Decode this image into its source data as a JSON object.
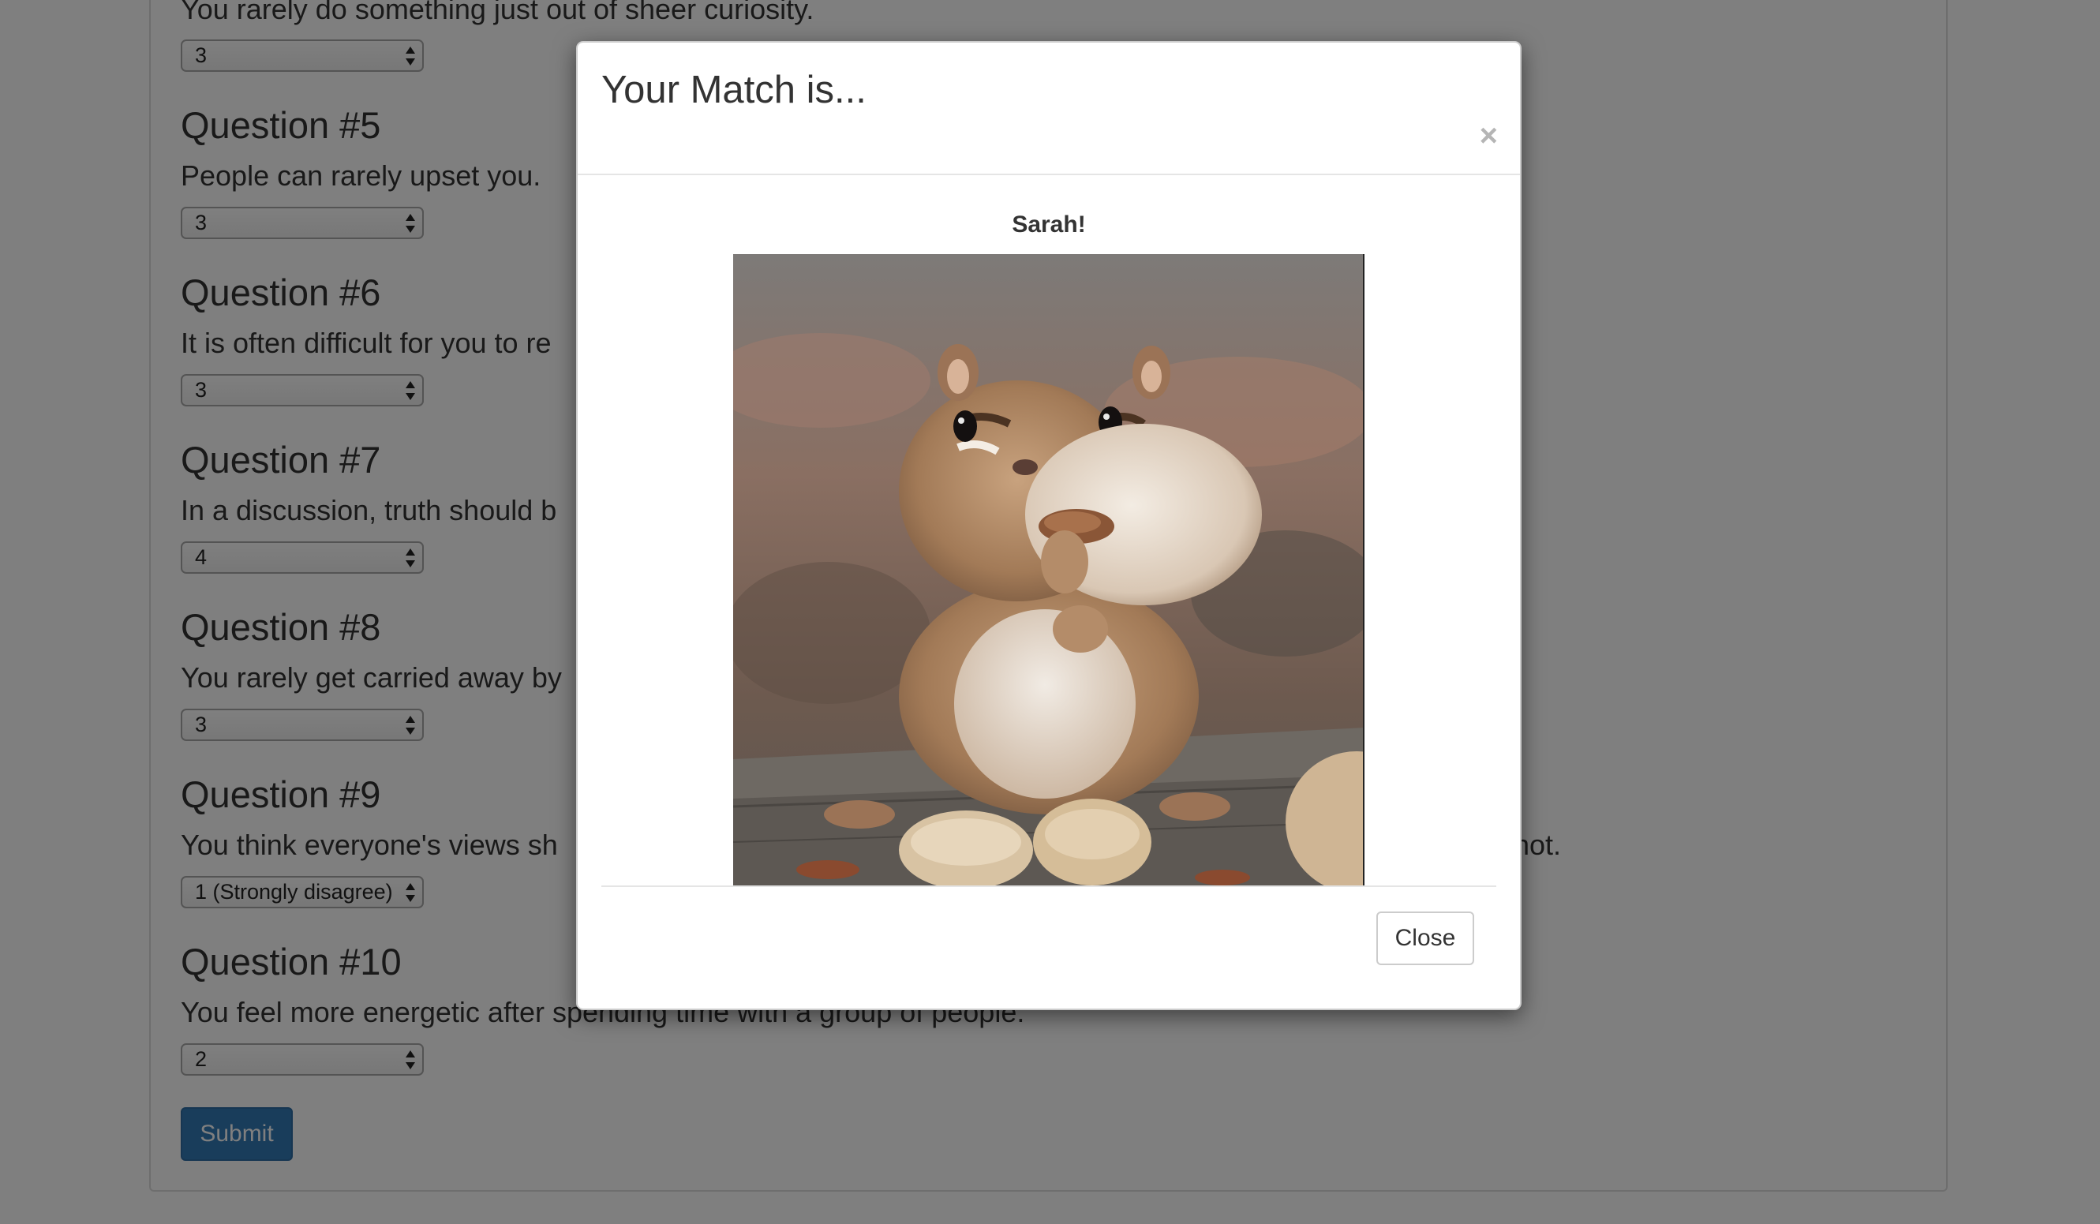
{
  "page": {
    "partial_question_text": "You rarely do something just out of sheer curiosity.",
    "partial_question_value": "3",
    "questions": [
      {
        "heading": "Question #5",
        "text": "People can rarely upset you.",
        "value": "3"
      },
      {
        "heading": "Question #6",
        "text": "It is often difficult for you to re",
        "value": "3"
      },
      {
        "heading": "Question #7",
        "text": "In a discussion, truth should b",
        "value": "4"
      },
      {
        "heading": "Question #8",
        "text": "You rarely get carried away by",
        "value": "3"
      },
      {
        "heading": "Question #9",
        "text": "You think everyone's views sh",
        "text_tail": "not.",
        "value": "1 (Strongly disagree)"
      },
      {
        "heading": "Question #10",
        "text": "You feel more energetic after spending time with a group of people.",
        "value": "2"
      }
    ],
    "submit_label": "Submit"
  },
  "modal": {
    "title": "Your Match is...",
    "close_symbol": "×",
    "match_name": "Sarah!",
    "photo_icon": "chipmunk-photo",
    "close_label": "Close"
  }
}
